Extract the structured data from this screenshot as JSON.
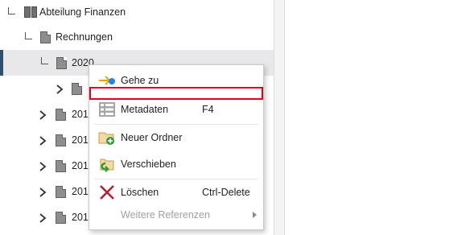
{
  "tree": {
    "items": [
      {
        "label": "Abteilung Finanzen"
      },
      {
        "label": "Rechnungen"
      },
      {
        "label": "2020"
      },
      {
        "label": ""
      },
      {
        "label": "201"
      },
      {
        "label": "201"
      },
      {
        "label": "201"
      },
      {
        "label": "201"
      },
      {
        "label": "201"
      }
    ]
  },
  "context_menu": {
    "items": [
      {
        "label": "Gehe zu",
        "shortcut": ""
      },
      {
        "label": "",
        "shortcut": ""
      },
      {
        "label": "Metadaten",
        "shortcut": "F4"
      },
      {
        "label": "Neuer Ordner",
        "shortcut": ""
      },
      {
        "label": "Verschieben",
        "shortcut": ""
      },
      {
        "label": "Löschen",
        "shortcut": "Ctrl-Delete"
      },
      {
        "label": "Weitere Referenzen",
        "shortcut": ""
      }
    ],
    "colors": {
      "highlight": "#e0001b",
      "accent_orange": "#f0a020",
      "accent_blue": "#1e88e5",
      "accent_green": "#2e9b3a",
      "delete_red": "#b0233a"
    }
  }
}
